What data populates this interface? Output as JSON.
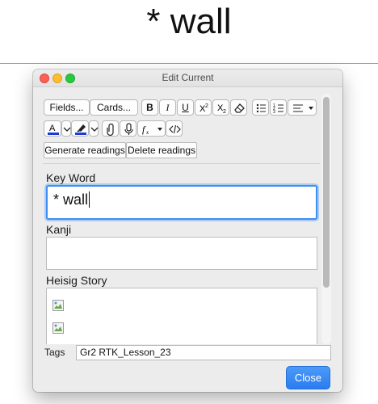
{
  "card": {
    "front_text": "* wall"
  },
  "window": {
    "title": "Edit Current"
  },
  "toolbar": {
    "fields_label": "Fields...",
    "cards_label": "Cards...",
    "bold_label": "B",
    "italic_label": "I",
    "underline_label": "U",
    "generate_readings_label": "Generate readings",
    "delete_readings_label": "Delete readings"
  },
  "colors": {
    "text_color_swatch": "#1f3bd6",
    "highlight_swatch": "#1f3bd6",
    "focus_ring": "#3d8ef5",
    "close_button": "#2a7cf0"
  },
  "fields": [
    {
      "label": "Key Word",
      "value": "* wall"
    },
    {
      "label": "Kanji",
      "value": ""
    },
    {
      "label": "Heisig Story",
      "images": [
        "broken-image-icon",
        "broken-image-icon"
      ]
    }
  ],
  "tags": {
    "label": "Tags",
    "value": "Gr2 RTK_Lesson_23"
  },
  "footer": {
    "close_label": "Close"
  }
}
